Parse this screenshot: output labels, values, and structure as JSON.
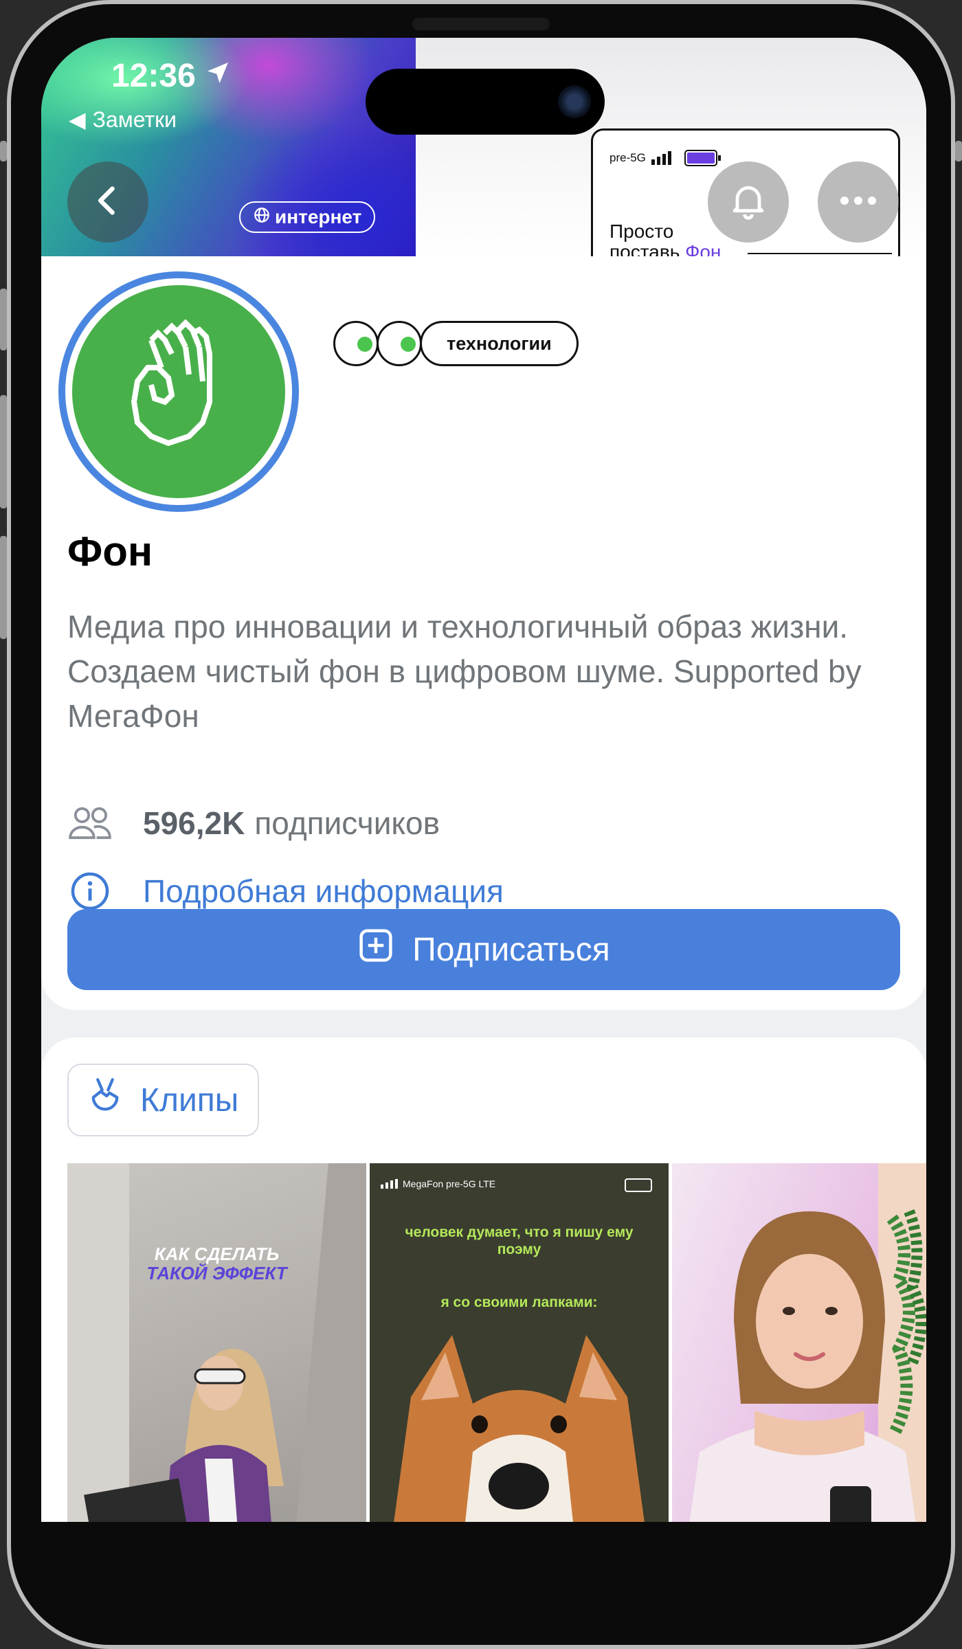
{
  "status_bar": {
    "time": "12:36",
    "back_app": "Заметки"
  },
  "header": {
    "chip_internet": "интернет",
    "ad": {
      "network": "pre-5G",
      "line1": "Просто",
      "line2_prefix": "поставь",
      "line2_brand": "Фон"
    },
    "icons": [
      "back-icon",
      "bell-icon",
      "more-icon"
    ]
  },
  "profile": {
    "badge": "технологии",
    "name": "Фон",
    "description": "Медиа про инновации и технологичный образ жизни. Создаем чистый фон в цифровом шуме. Supported by МегаФон",
    "followers_count": "596,2K",
    "followers_label": "подписчиков",
    "more_info": "Подробная информация",
    "subscribe": "Подписаться"
  },
  "clips": {
    "tab_label": "Клипы",
    "items": [
      {
        "line1": "КАК СДЕЛАТЬ",
        "line2": "ТАКОЙ ЭФФЕКТ"
      },
      {
        "status": "MegaFon pre-5G LTE",
        "caption1": "человек думает, что я пишу ему поэму",
        "caption2": "я со своими лапками:"
      },
      {}
    ]
  },
  "colors": {
    "accent": "#4880dc",
    "link": "#3f7bd6",
    "avatar_green": "#48b04a",
    "brand_purple": "#6a3ee0"
  }
}
